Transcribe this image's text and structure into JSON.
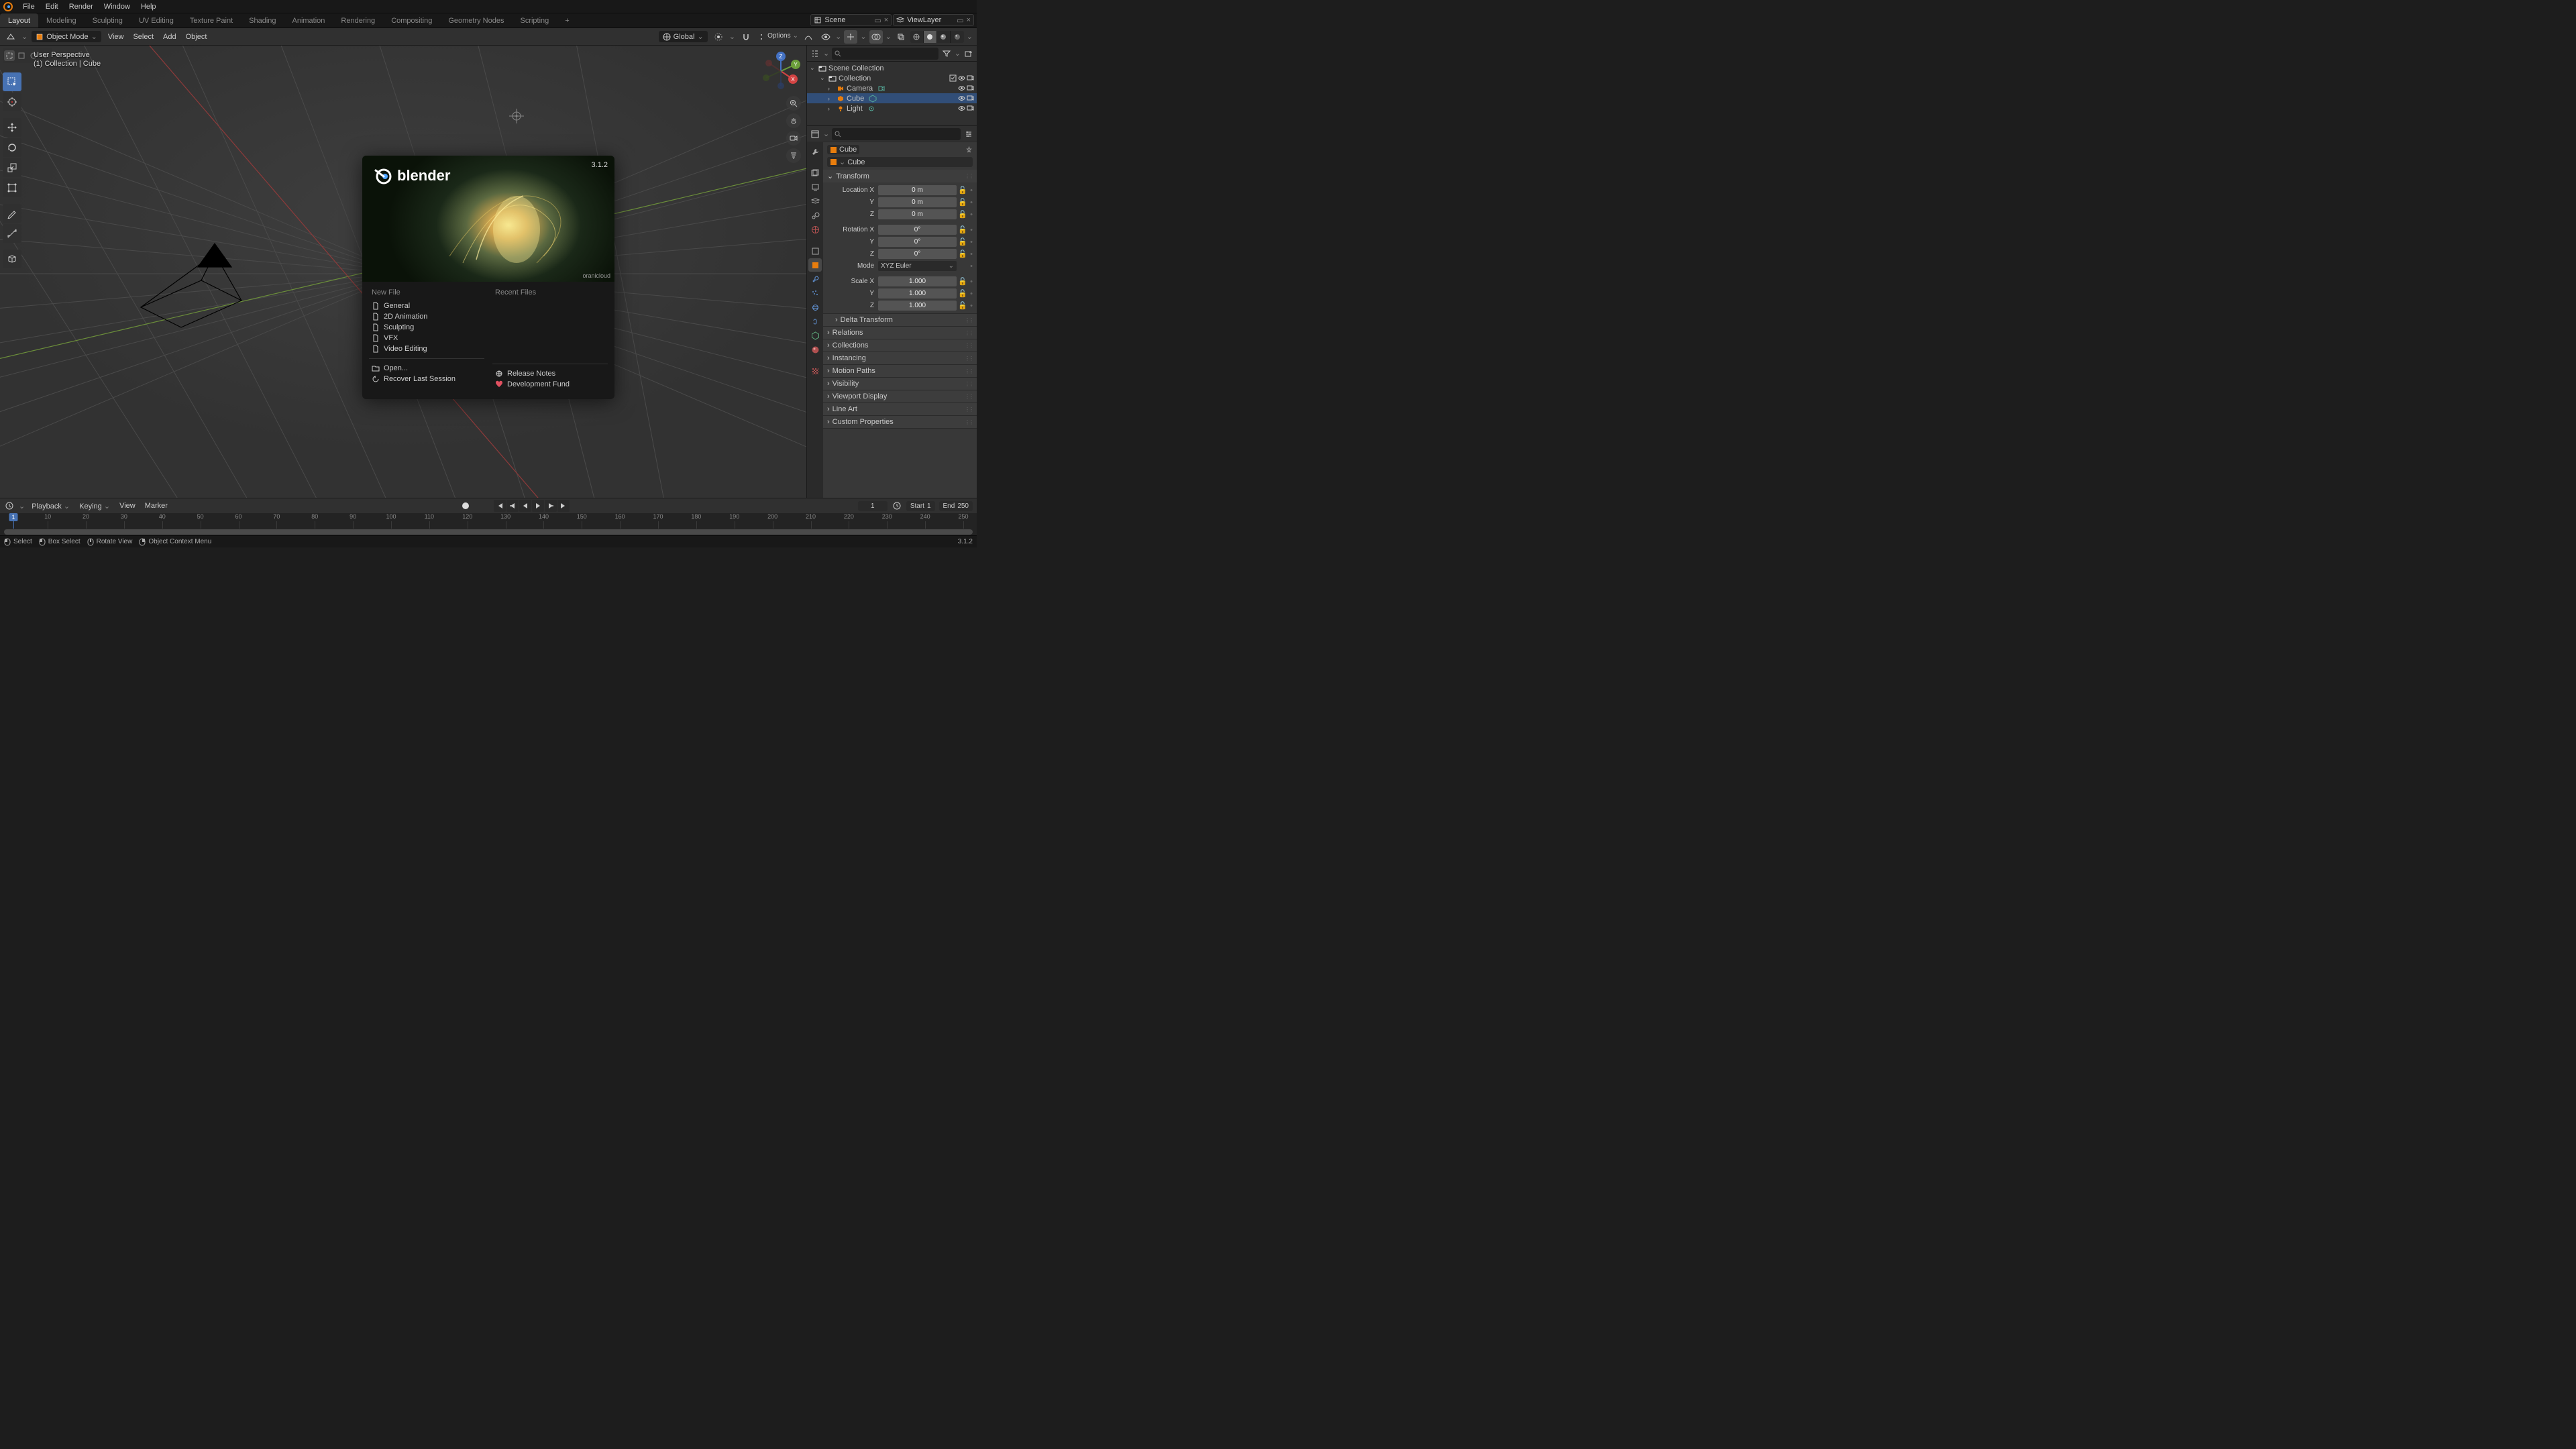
{
  "app": {
    "version_short": "3.1.2"
  },
  "topmenu": [
    "File",
    "Edit",
    "Render",
    "Window",
    "Help"
  ],
  "workspaces": [
    "Layout",
    "Modeling",
    "Sculpting",
    "UV Editing",
    "Texture Paint",
    "Shading",
    "Animation",
    "Rendering",
    "Compositing",
    "Geometry Nodes",
    "Scripting"
  ],
  "workspace_active": 0,
  "scene_name": "Scene",
  "viewlayer_name": "ViewLayer",
  "viewport_header": {
    "mode": "Object Mode",
    "menus": [
      "View",
      "Select",
      "Add",
      "Object"
    ],
    "orientation": "Global",
    "options_label": "Options"
  },
  "viewport_overlay": {
    "line1": "User Perspective",
    "line2": "(1) Collection | Cube"
  },
  "outliner": {
    "root": "Scene Collection",
    "items": [
      {
        "name": "Collection",
        "children": [
          {
            "name": "Camera",
            "kind": "camera"
          },
          {
            "name": "Cube",
            "kind": "mesh",
            "selected": true
          },
          {
            "name": "Light",
            "kind": "light"
          }
        ]
      }
    ]
  },
  "properties": {
    "object_name": "Cube",
    "data_name": "Cube",
    "transform": {
      "location": [
        "0 m",
        "0 m",
        "0 m"
      ],
      "rotation": [
        "0°",
        "0°",
        "0°"
      ],
      "rotation_mode": "XYZ Euler",
      "scale": [
        "1.000",
        "1.000",
        "1.000"
      ]
    },
    "section_labels": {
      "transform": "Transform",
      "delta": "Delta Transform",
      "relations": "Relations",
      "collections": "Collections",
      "instancing": "Instancing",
      "motion": "Motion Paths",
      "visibility": "Visibility",
      "viewport": "Viewport Display",
      "lineart": "Line Art",
      "custom": "Custom Properties"
    },
    "axis_labels": {
      "locx": "Location X",
      "rotx": "Rotation X",
      "sclx": "Scale X",
      "y": "Y",
      "z": "Z",
      "mode": "Mode"
    }
  },
  "timeline": {
    "menus": [
      "Playback",
      "Keying",
      "View",
      "Marker"
    ],
    "current": 1,
    "start_label": "Start",
    "start": 1,
    "end_label": "End",
    "end": 250,
    "ticks": [
      1,
      10,
      20,
      30,
      40,
      50,
      60,
      70,
      80,
      90,
      100,
      110,
      120,
      130,
      140,
      150,
      160,
      170,
      180,
      190,
      200,
      210,
      220,
      230,
      240,
      250
    ]
  },
  "statusbar": {
    "items": [
      "Select",
      "Box Select",
      "Rotate View",
      "Object Context Menu"
    ],
    "version": "3.1.2"
  },
  "splash": {
    "version": "3.1.2",
    "credit": "oranicloud",
    "logo_text": "blender",
    "newfile_h": "New File",
    "recent_h": "Recent Files",
    "templates": [
      "General",
      "2D Animation",
      "Sculpting",
      "VFX",
      "Video Editing"
    ],
    "open": "Open...",
    "recover": "Recover Last Session",
    "release": "Release Notes",
    "fund": "Development Fund"
  }
}
